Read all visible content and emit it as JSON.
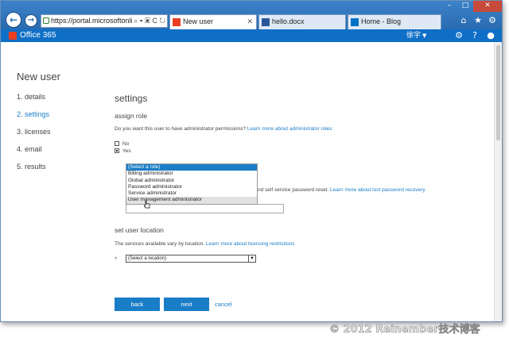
{
  "browser": {
    "address": "https://portal.microsoftonli...",
    "tabs": [
      {
        "label": "New user",
        "active": true
      },
      {
        "label": "hello.docx",
        "active": false
      },
      {
        "label": "Home - Blog",
        "active": false
      }
    ],
    "window_controls": {
      "minimize": "–",
      "maximize": "□",
      "close": "✕"
    },
    "chrome_icons": [
      "home-icon",
      "star-icon",
      "gear-icon"
    ]
  },
  "topbar": {
    "logo": "Office 365",
    "user": "徐宇",
    "icons": [
      "gear-icon",
      "help-icon",
      "user-icon"
    ]
  },
  "page": {
    "title": "New user",
    "steps": [
      {
        "label": "1.  details",
        "current": false
      },
      {
        "label": "2.  settings",
        "current": true
      },
      {
        "label": "3.  licenses",
        "current": false
      },
      {
        "label": "4.  email",
        "current": false
      },
      {
        "label": "5.  results",
        "current": false
      }
    ]
  },
  "settings": {
    "heading": "settings",
    "assign_role": {
      "label": "assign role",
      "question": "Do you want this user to have administrator permissions? ",
      "learn_more": "Learn more about administrator roles",
      "options": [
        {
          "label": "No",
          "checked": false
        },
        {
          "label": "Yes",
          "checked": true
        }
      ]
    },
    "role_dropdown": {
      "options": [
        "(Select a role)",
        "Billing administrator",
        "Global administrator",
        "Password administrator",
        "Service administrator",
        "User management administrator"
      ],
      "selected_index": 0,
      "hover_index": 5
    },
    "password_text": "nd self service password reset. ",
    "password_link": "Learn more about lost password recovery",
    "location": {
      "label": "set user location",
      "text": "The services available vary by location. ",
      "link": "Learn more about licensing restrictions",
      "required_marker": "*",
      "select_placeholder": "(Select a location)"
    }
  },
  "actions": {
    "back": "back",
    "next": "next",
    "cancel": "cancel"
  },
  "watermark": "© 2012 Reinember技术博客",
  "colors": {
    "accent": "#1a7dc7",
    "topbar": "#0f6fc6",
    "chrome": "#2a6bb0"
  }
}
